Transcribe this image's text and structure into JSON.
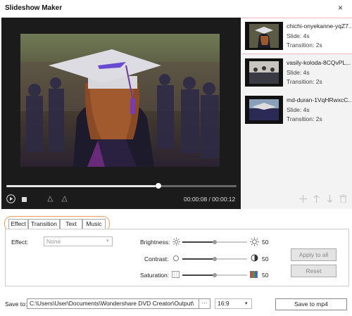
{
  "window": {
    "title": "Slideshow Maker",
    "close_icon": "×"
  },
  "player": {
    "time_display": "00:00:08 / 00:00:12",
    "progress_fraction": 0.667
  },
  "slides": [
    {
      "name": "chichi-onyekanne-yqZ7...",
      "slide": "Slide: 4s",
      "transition": "Transition: 2s",
      "selected": true
    },
    {
      "name": "vasily-koloda-8CQvPL...",
      "slide": "Slide: 4s",
      "transition": "Transition: 2s",
      "selected": false
    },
    {
      "name": "md-duran-1VqHRwxcC...",
      "slide": "Slide: 4s",
      "transition": "Transition: 2s",
      "selected": false
    }
  ],
  "tabs": [
    "Effect",
    "Transition",
    "Text",
    "Music"
  ],
  "effect": {
    "label": "Effect:",
    "value": "None",
    "brightness_label": "Brightness:",
    "brightness_value": "50",
    "contrast_label": "Contrast:",
    "contrast_value": "50",
    "saturation_label": "Saturation:",
    "saturation_value": "50",
    "apply_all": "Apply to all",
    "reset": "Reset"
  },
  "output": {
    "save_to_label": "Save to:",
    "path": "C:\\Users\\User\\Documents\\Wondershare DVD Creator\\Output\\",
    "browse": "···",
    "ratio": "16:9",
    "save_button": "Save to mp4"
  },
  "colors": {
    "accent_orange": "#f0a05a",
    "selected_border": "#f2b8bd"
  }
}
